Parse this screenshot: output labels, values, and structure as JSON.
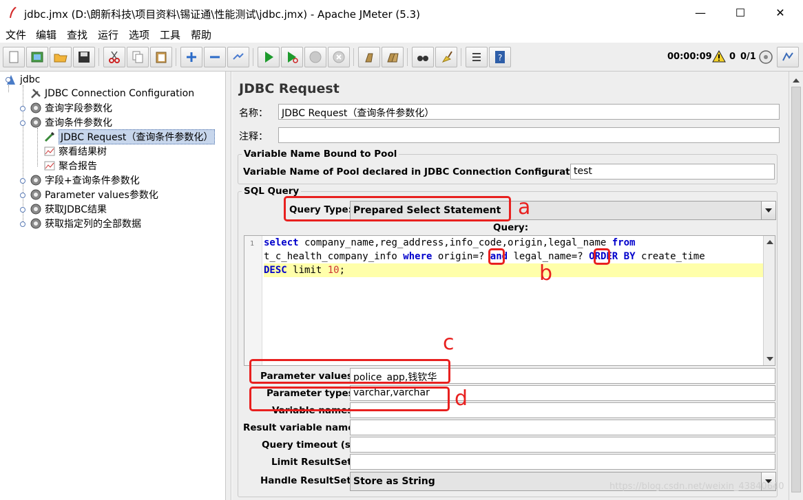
{
  "window": {
    "title": "jdbc.jmx (D:\\朗新科技\\项目资料\\锡证通\\性能测试\\jdbc.jmx) - Apache JMeter (5.3)",
    "minimize": "—",
    "maximize": "☐",
    "close": "✕"
  },
  "menu": [
    "文件",
    "编辑",
    "查找",
    "运行",
    "选项",
    "工具",
    "帮助"
  ],
  "toolbar": {
    "timer": "00:00:09",
    "warnings": "0",
    "threads": "0/1"
  },
  "tree": {
    "root": "jdbc",
    "items": [
      "JDBC Connection Configuration",
      "查询字段参数化",
      "查询条件参数化",
      "JDBC Request（查询条件参数化）",
      "察看结果树",
      "聚合报告",
      "字段+查询条件参数化",
      "Parameter values参数化",
      "获取JDBC结果",
      "获取指定列的全部数据"
    ]
  },
  "panel": {
    "title": "JDBC Request",
    "name_label": "名称：",
    "name_value": "JDBC Request（查询条件参数化）",
    "comment_label": "注释：",
    "comment_value": "",
    "pool_section": "Variable Name Bound to Pool",
    "pool_label": "Variable Name of Pool declared in JDBC Connection Configuration:",
    "pool_value": "test",
    "sql_section": "SQL Query",
    "query_type_label": "Query Type:",
    "query_type_value": "Prepared Select Statement",
    "query_label": "Query:",
    "line_number": "1",
    "param_values_label": "Parameter values:",
    "param_values": "police_app,钱钦华",
    "param_types_label": "Parameter types:",
    "param_types": "varchar,varchar",
    "var_names_label": "Variable names:",
    "var_names": "",
    "result_var_label": "Result variable name:",
    "result_var": "",
    "timeout_label": "Query timeout (s):",
    "timeout": "",
    "limit_label": "Limit ResultSet:",
    "limit": "",
    "handle_label": "Handle ResultSet:",
    "handle_value": "Store as String"
  },
  "code": {
    "l1_kw1": "select",
    "l1_text": " company_name,reg_address,info_code,origin,legal_name ",
    "l1_kw2": "from",
    "l2_text1": "t_c_health_company_info ",
    "l2_kw1": "where",
    "l2_text2": " origin=",
    "l2_q1": "?",
    "l2_sp": " ",
    "l2_kw2": "and",
    "l2_text3": " legal_name=",
    "l2_q2": "?",
    "l2_kw3": " ORDER BY",
    "l2_text4": " create_time",
    "l3_kw1": "DESC",
    "l3_text1": " limit ",
    "l3_num": "10",
    "l3_text2": ";"
  },
  "annotations": {
    "a": "a",
    "b": "b",
    "c": "c",
    "d": "d"
  },
  "watermark": "https://blog.csdn.net/weixin_43840640"
}
